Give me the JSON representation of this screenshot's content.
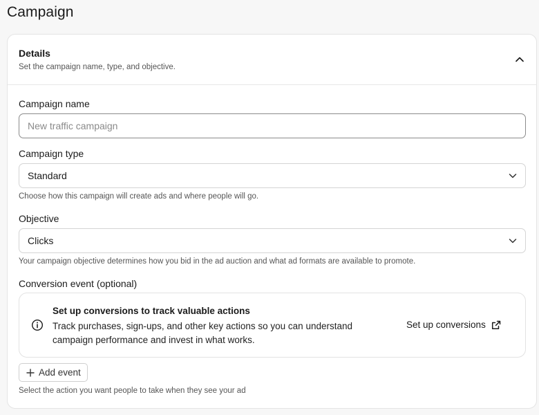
{
  "page": {
    "title": "Campaign"
  },
  "details": {
    "title": "Details",
    "subtitle": "Set the campaign name, type, and objective.",
    "collapse_icon": "chevron-up-icon"
  },
  "campaign_name": {
    "label": "Campaign name",
    "value": "",
    "placeholder": "New traffic campaign"
  },
  "campaign_type": {
    "label": "Campaign type",
    "selected": "Standard",
    "help": "Choose how this campaign will create ads and where people will go.",
    "icon": "chevron-down-icon"
  },
  "objective": {
    "label": "Objective",
    "selected": "Clicks",
    "help": "Your campaign objective determines how you bid in the ad auction and what ad formats are available to promote.",
    "icon": "chevron-down-icon"
  },
  "conversion_event": {
    "label": "Conversion event (optional)",
    "info": {
      "icon": "info-icon",
      "title": "Set up conversions to track valuable actions",
      "body": "Track purchases, sign-ups, and other key actions so you can understand campaign performance and invest in what works.",
      "link_label": "Set up conversions",
      "link_icon": "external-link-icon"
    },
    "add_button_label": "Add event",
    "add_button_icon": "plus-icon",
    "help": "Select the action you want people to take when they see your ad"
  },
  "colors": {
    "background": "#f7f7f7",
    "card": "#ffffff",
    "border": "#e4e4e4",
    "text": "#1a1a1a",
    "muted_text": "#555555"
  }
}
